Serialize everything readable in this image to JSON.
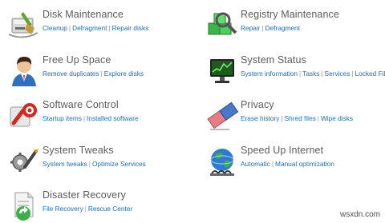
{
  "tiles": [
    {
      "title": "Disk Maintenance",
      "icon": "disk-cleanup-icon",
      "links": [
        "Cleanup",
        "Defragment",
        "Repair disks"
      ]
    },
    {
      "title": "Registry Maintenance",
      "icon": "registry-cubes-icon",
      "links": [
        "Repair",
        "Defragment"
      ]
    },
    {
      "title": "Free Up Space",
      "icon": "user-icon",
      "links": [
        "Remove duplicates",
        "Explore disks"
      ]
    },
    {
      "title": "System Status",
      "icon": "monitor-icon",
      "links": [
        "System information",
        "Tasks",
        "Services",
        "Locked Files"
      ]
    },
    {
      "title": "Software Control",
      "icon": "software-control-icon",
      "links": [
        "Startup items",
        "Installed software"
      ]
    },
    {
      "title": "Privacy",
      "icon": "eraser-icon",
      "links": [
        "Erase history",
        "Shred files",
        "Wipe disks"
      ]
    },
    {
      "title": "System Tweaks",
      "icon": "tools-icon",
      "links": [
        "System tweaks",
        "Optimize Services"
      ]
    },
    {
      "title": "Speed Up Internet",
      "icon": "globe-icon",
      "links": [
        "Automatic",
        "Manual optimization"
      ]
    },
    {
      "title": "Disaster Recovery",
      "icon": "recovery-icon",
      "links": [
        "File Recovery",
        "Rescue Center"
      ]
    }
  ],
  "watermark": "wsxdn.com"
}
